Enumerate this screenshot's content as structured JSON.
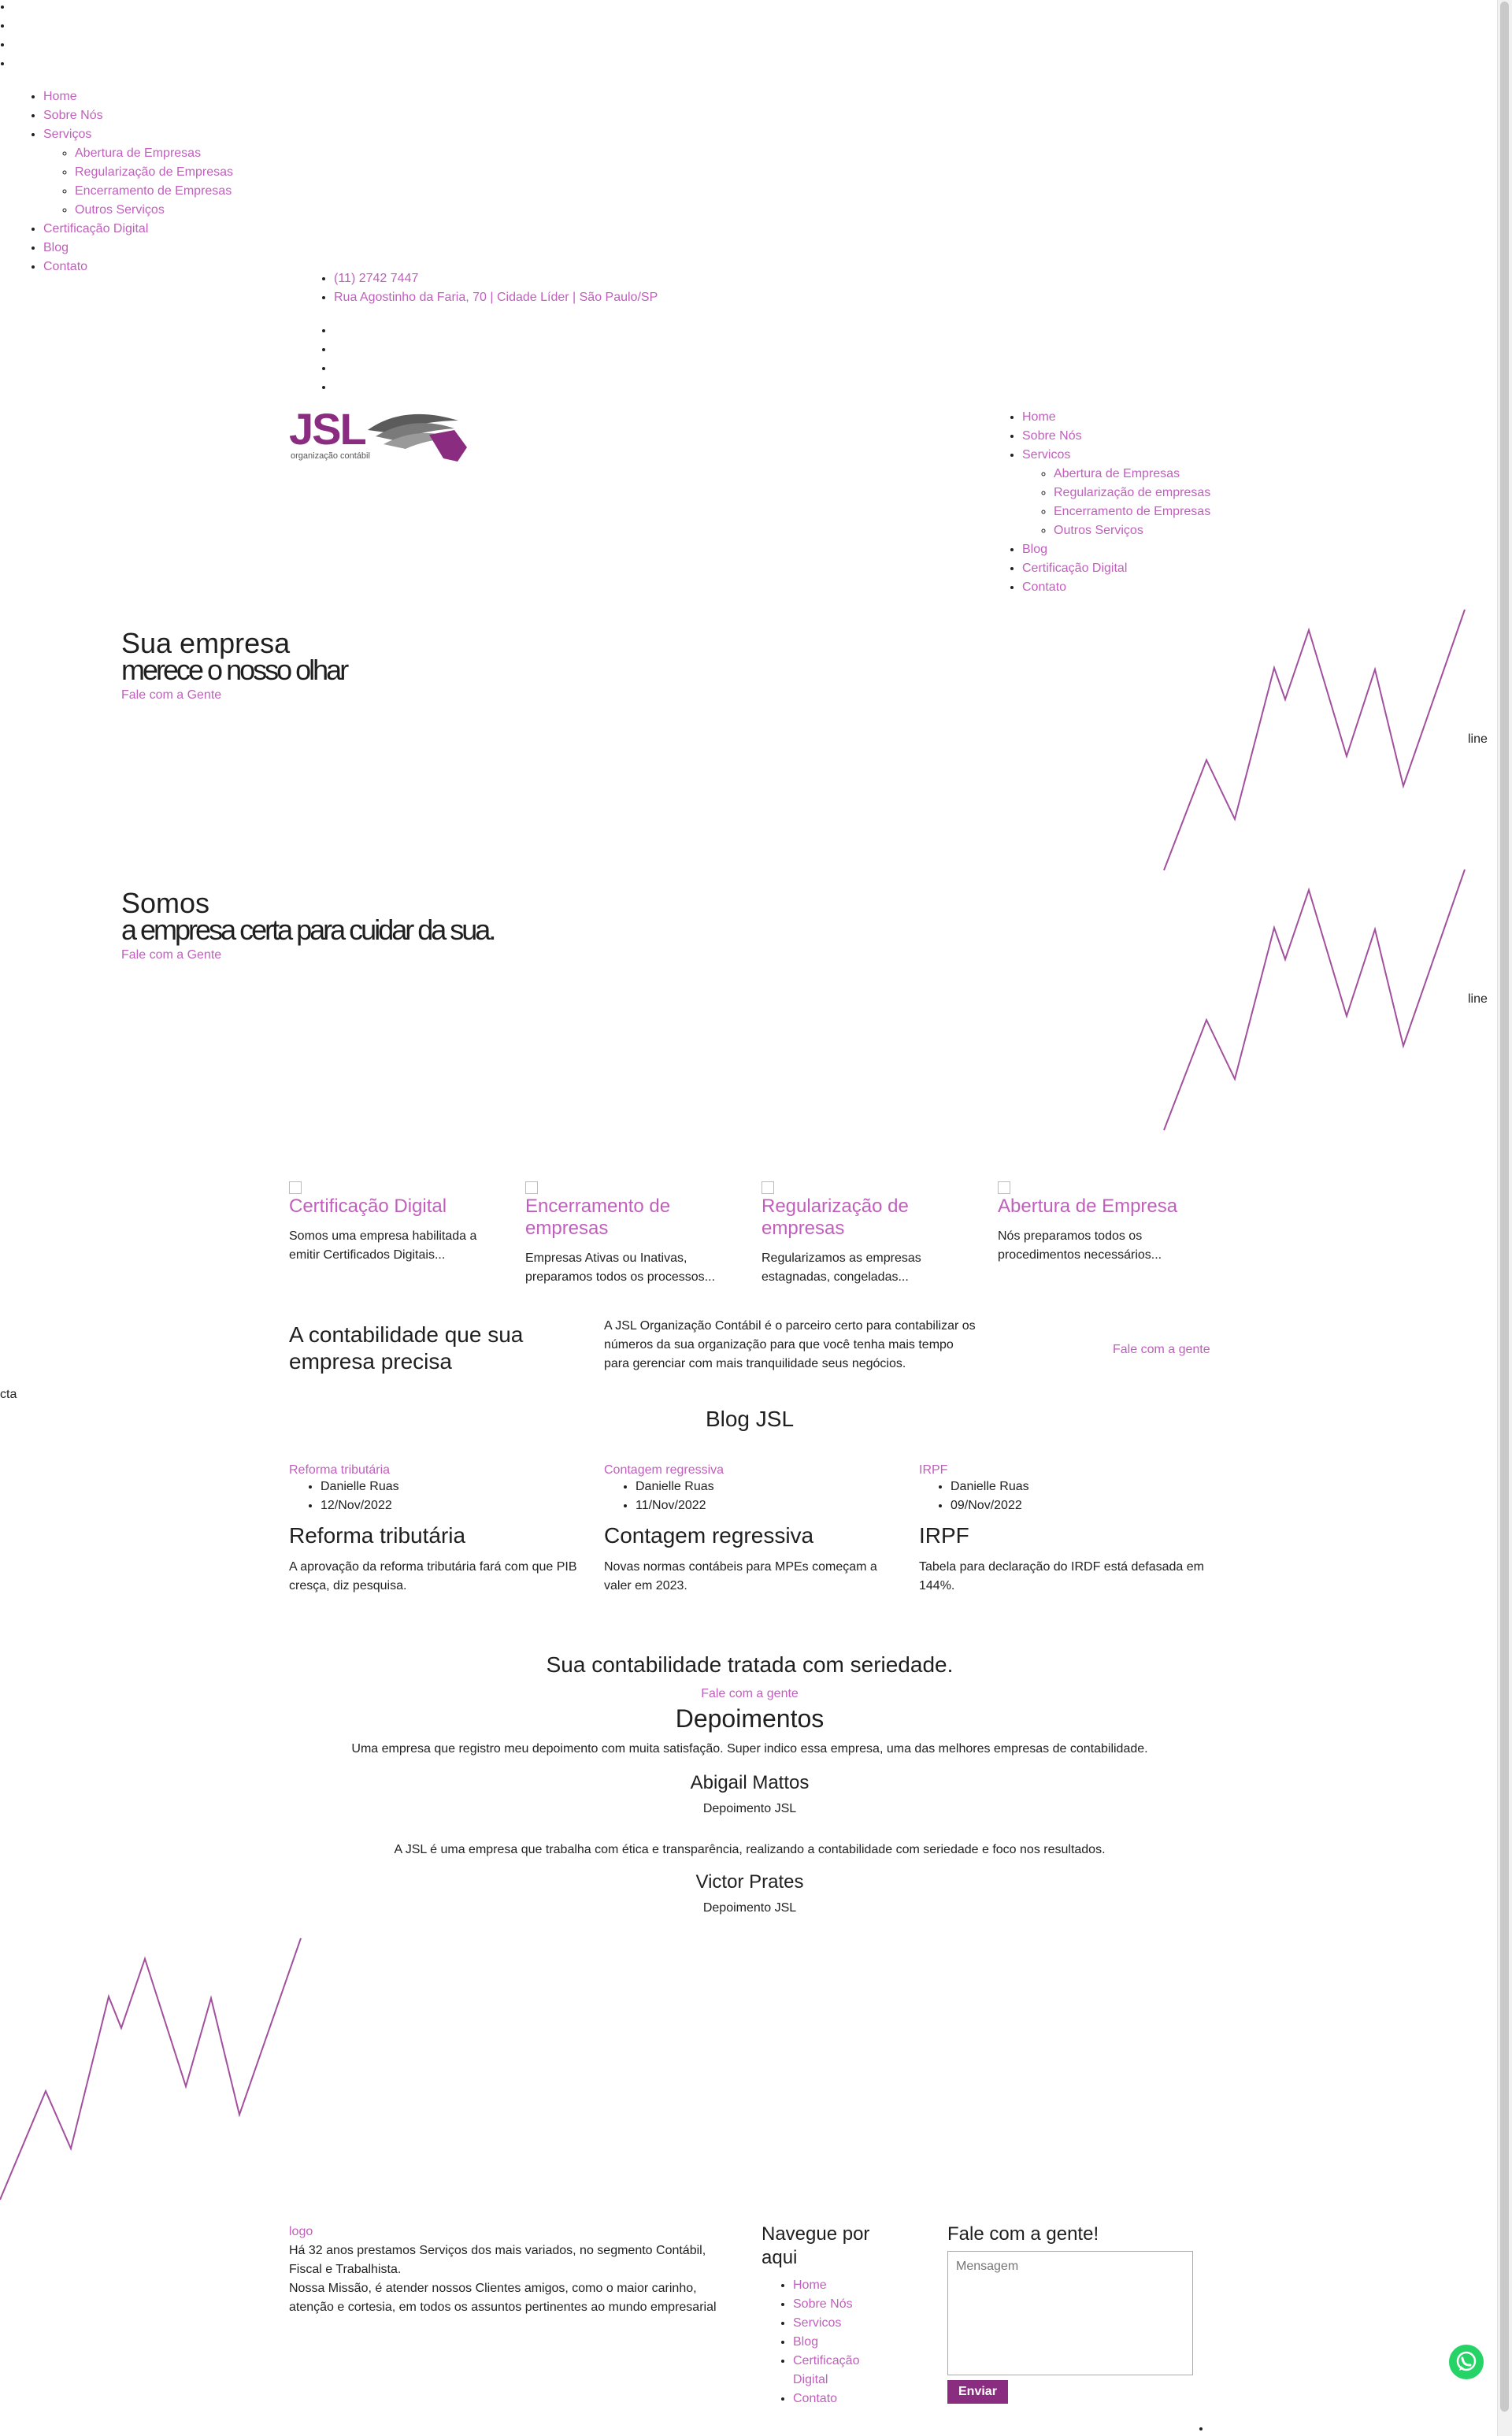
{
  "top_bullets": [
    "",
    "",
    "",
    ""
  ],
  "mobile_menu": {
    "items": [
      {
        "label": "Home"
      },
      {
        "label": "Sobre Nós"
      },
      {
        "label": "Serviços",
        "children": [
          "Abertura de Empresas",
          "Regularização de Empresas",
          "Encerramento de Empresas",
          "Outros Serviços"
        ]
      },
      {
        "label": "Certificação Digital"
      },
      {
        "label": "Blog"
      },
      {
        "label": "Contato"
      }
    ]
  },
  "contact_bar": {
    "phone": "(11) 2742 7447",
    "address": "Rua Agostinho da Faria, 70 | Cidade Líder | São Paulo/SP",
    "social_bullets": [
      "",
      "",
      "",
      ""
    ]
  },
  "logo": {
    "letters": "JSL",
    "tagline": "organização contábil"
  },
  "main_menu": {
    "items": [
      "Home",
      "Sobre Nós",
      "Servicos"
    ],
    "services": [
      "Abertura de Empresas",
      "Regularização de empresas",
      "Encerramento de Empresas",
      "Outros Serviços"
    ],
    "items_after": [
      "Blog",
      "Certificação Digital",
      "Contato"
    ]
  },
  "slides": [
    {
      "line1": "Sua empresa",
      "line2": "merece o nosso olhar",
      "cta": "Fale com a Gente",
      "img_alt": "line"
    },
    {
      "line1": "Somos",
      "line2": "a empresa certa para cuidar da sua.",
      "cta": "Fale com a Gente",
      "img_alt": "line"
    }
  ],
  "services": [
    {
      "title": "Certificação Digital",
      "text": "Somos uma empresa habilitada a emitir Certificados Digitais..."
    },
    {
      "title": "Encerramento de empresas",
      "text": "Empresas Ativas ou Inativas, preparamos todos os processos..."
    },
    {
      "title": "Regularização de empresas",
      "text": "Regularizamos as empresas estagnadas, congeladas..."
    },
    {
      "title": "Abertura de Empresa",
      "text": "Nós preparamos todos os procedimentos necessários..."
    }
  ],
  "cta_band": {
    "title": "A contabilidade que sua empresa precisa",
    "text": "A JSL Organização Contábil é o parceiro certo para contabilizar os números da sua organização para que você tenha mais tempo para gerenciar com mais tranquilidade seus negócios.",
    "link": "Fale com a gente",
    "img_alt": "cta"
  },
  "blog": {
    "heading": "Blog JSL",
    "posts": [
      {
        "img_alt": "Reforma tributária",
        "author": "Danielle Ruas",
        "date": "12/Nov/2022",
        "title": "Reforma tributária",
        "excerpt": "A aprovação da reforma tributária fará com que PIB cresça, diz pesquisa."
      },
      {
        "img_alt": "Contagem regressiva",
        "author": "Danielle Ruas",
        "date": "11/Nov/2022",
        "title": "Contagem regressiva",
        "excerpt": "Novas normas contábeis para MPEs começam a valer em 2023."
      },
      {
        "img_alt": "IRPF",
        "author": "Danielle Ruas",
        "date": "09/Nov/2022",
        "title": "IRPF",
        "excerpt": "Tabela para declaração do IRDF está defasada em 144%."
      }
    ]
  },
  "seriedade": {
    "title": "Sua contabilidade tratada com seriedade.",
    "link": "Fale com a gente"
  },
  "testimonials": {
    "heading": "Depoimentos",
    "items": [
      {
        "text": "Uma empresa que registro meu depoimento com muita satisfação. Super indico essa empresa, uma das melhores empresas de contabilidade.",
        "name": "Abigail Mattos",
        "img_alt": "Depoimento JSL"
      },
      {
        "text": "A JSL é uma empresa que trabalha com ética e transparência, realizando a contabilidade com seriedade e foco nos resultados.",
        "name": "Victor Prates",
        "img_alt": "Depoimento JSL"
      }
    ]
  },
  "footer": {
    "logo_alt": "logo",
    "about_line1": "Há 32 anos prestamos Serviços dos mais variados, no segmento Contábil, Fiscal e Trabalhista.",
    "about_line2": "Nossa Missão, é atender nossos Clientes amigos, como o maior carinho, atenção e cortesia, em todos os assuntos pertinentes ao mundo empresarial",
    "nav_title": "Navegue por aqui",
    "nav": [
      "Home",
      "Sobre Nós",
      "Servicos",
      "Blog",
      "Certificação Digital",
      "Contato"
    ],
    "form_title": "Fale com a gente!",
    "message_placeholder": "Mensagem",
    "submit": "Enviar"
  },
  "colors": {
    "accent": "#c15fbd",
    "brand": "#8a2d80",
    "whatsapp": "#25d366"
  }
}
